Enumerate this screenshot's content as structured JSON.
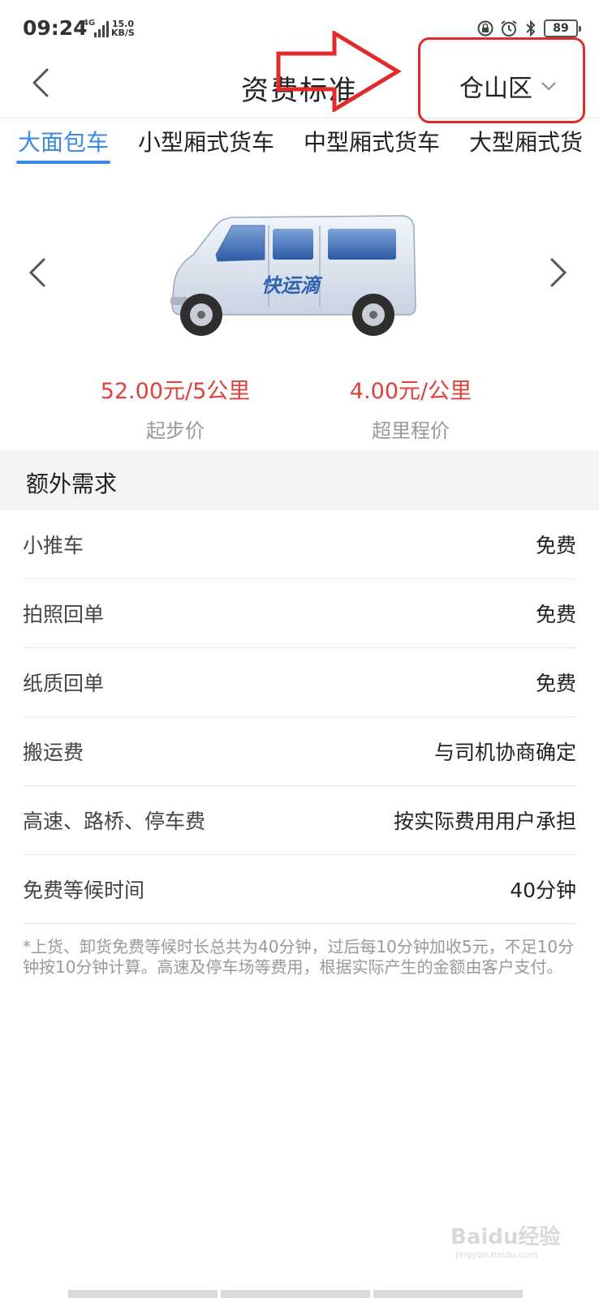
{
  "status": {
    "time": "09:24",
    "network": "4G",
    "speed_value": "15.0",
    "speed_unit": "KB/S",
    "battery": "89"
  },
  "header": {
    "title": "资费标准",
    "district": "仓山区"
  },
  "tabs": [
    {
      "label": "大面包车",
      "active": true
    },
    {
      "label": "小型厢式货车",
      "active": false
    },
    {
      "label": "中型厢式货车",
      "active": false
    },
    {
      "label": "大型厢式货",
      "active": false
    }
  ],
  "vehicle": {
    "brand_text": "快运滴",
    "start_price": "52.00元/5公里",
    "start_price_label": "起步价",
    "extra_price": "4.00元/公里",
    "extra_price_label": "超里程价"
  },
  "extras": {
    "title": "额外需求",
    "rows": [
      {
        "label": "小推车",
        "value": "免费"
      },
      {
        "label": "拍照回单",
        "value": "免费"
      },
      {
        "label": "纸质回单",
        "value": "免费"
      },
      {
        "label": "搬运费",
        "value": "与司机协商确定"
      },
      {
        "label": "高速、路桥、停车费",
        "value": "按实际费用用户承担"
      },
      {
        "label": "免费等候时间",
        "value": "40分钟"
      }
    ],
    "note": "*上货、卸货免费等候时长总共为40分钟，过后每10分钟加收5元，不足10分钟按10分钟计算。高速及停车场等费用，根据实际产生的金额由客户支付。"
  },
  "watermark": {
    "text": "Baidu经验",
    "sub": "jingyan.baidu.com"
  },
  "colors": {
    "accent": "#3d8ae5",
    "price": "#e0403a",
    "annotation": "#e12b2b"
  }
}
